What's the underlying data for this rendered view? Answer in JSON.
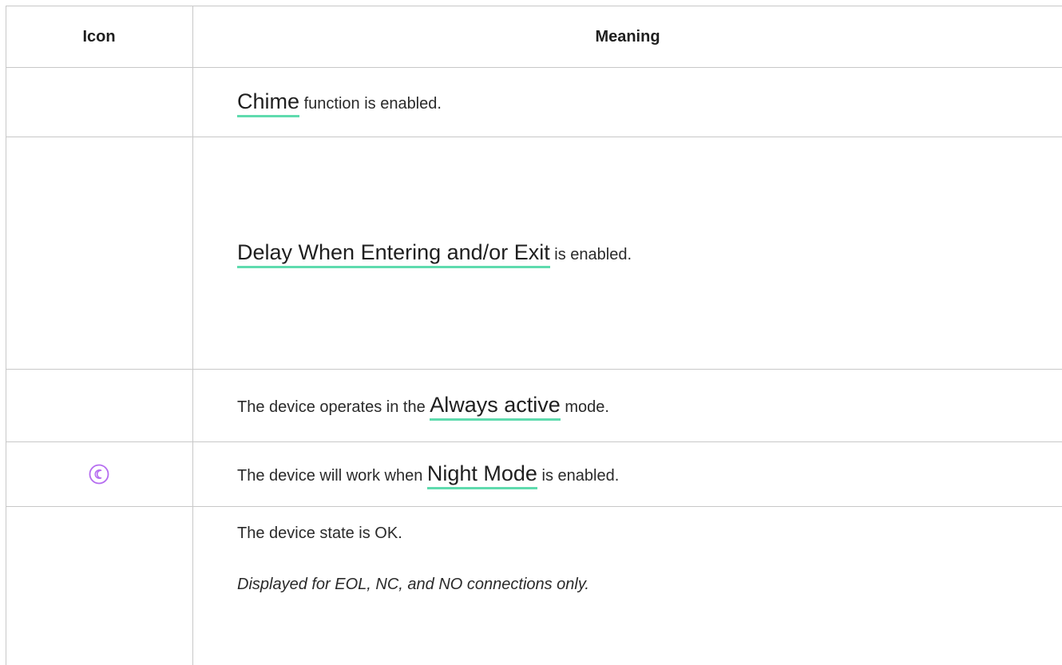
{
  "table": {
    "headers": {
      "icon": "Icon",
      "meaning": "Meaning"
    },
    "rows": [
      {
        "link": "Chime",
        "suffix": " function is enabled."
      },
      {
        "link": "Delay When Entering and/or Exit",
        "suffix": " is enabled."
      },
      {
        "prefix": "The device operates in the ",
        "link": "Always active",
        "suffix": " mode."
      },
      {
        "icon": "night-mode-icon",
        "icon_color": "#b56cf0",
        "prefix": "The device will work when ",
        "link": "Night Mode",
        "suffix": " is enabled."
      },
      {
        "text": "The device state is OK.",
        "note": "Displayed for EOL, NC, and NO connections only."
      }
    ]
  },
  "colors": {
    "link_underline": "#5fdbae",
    "border": "#c8c8c8"
  }
}
